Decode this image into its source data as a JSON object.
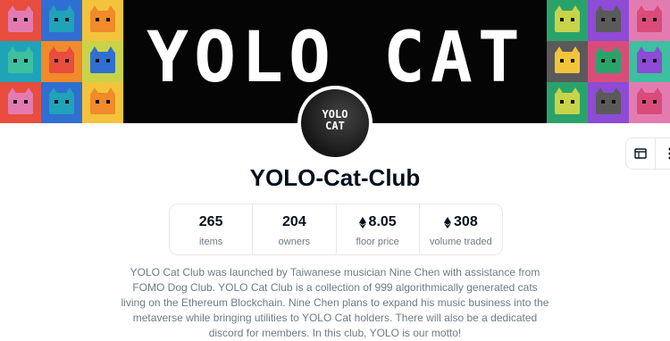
{
  "banner": {
    "title": "YOLO CAT",
    "tile_colors": [
      "#e84d3d",
      "#2f6fd1",
      "#f3c43b",
      "#2aa36b",
      "#8d4bd6",
      "#e37bb0",
      "#1fa3b8",
      "#f08a2b",
      "#c8d34a",
      "#5a5a5a",
      "#d94c7a",
      "#3dbfa0"
    ]
  },
  "collection": {
    "avatar_text_line1": "YOLO",
    "avatar_text_line2": "CAT",
    "name": "YOLO-Cat-Club",
    "stats": [
      {
        "value": "265",
        "label": "items",
        "eth": false
      },
      {
        "value": "204",
        "label": "owners",
        "eth": false
      },
      {
        "value": "8.05",
        "label": "floor price",
        "eth": true
      },
      {
        "value": "308",
        "label": "volume traded",
        "eth": true
      }
    ],
    "description": "YOLO Cat Club was launched by Taiwanese musician Nine Chen with assistance from FOMO Dog Club. YOLO Cat Club is a collection of 999 algorithmically generated cats living on the Ethereum Blockchain. Nine Chen plans to expand his music business into the metaverse while bringing utilities to YOLO Cat holders. There will also be a dedicated discord for members. In this club, YOLO is our motto!"
  },
  "side_actions": [
    {
      "icon": "website-icon"
    },
    {
      "icon": "more-vertical-icon"
    }
  ]
}
